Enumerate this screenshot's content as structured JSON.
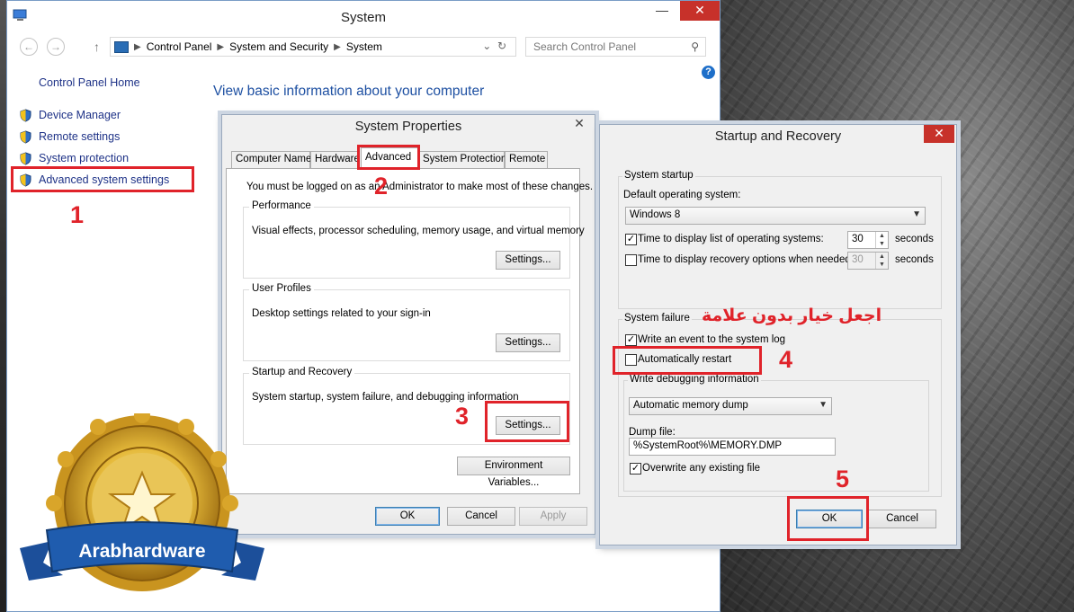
{
  "system_window": {
    "title": "System",
    "breadcrumb": [
      "Control Panel",
      "System and Security",
      "System"
    ],
    "search_placeholder": "Search Control Panel",
    "help_label": "?",
    "left_nav": {
      "home": "Control Panel Home",
      "items": [
        "Device Manager",
        "Remote settings",
        "System protection",
        "Advanced system settings"
      ]
    },
    "heading": "View basic information about your computer"
  },
  "system_properties": {
    "title": "System Properties",
    "tabs": [
      "Computer Name",
      "Hardware",
      "Advanced",
      "System Protection",
      "Remote"
    ],
    "active_tab": "Advanced",
    "admin_note": "You must be logged on as an Administrator to make most of these changes.",
    "performance": {
      "label": "Performance",
      "description": "Visual effects, processor scheduling, memory usage, and virtual memory",
      "button": "Settings..."
    },
    "user_profiles": {
      "label": "User Profiles",
      "description": "Desktop settings related to your sign-in",
      "button": "Settings..."
    },
    "startup_recovery": {
      "label": "Startup and Recovery",
      "description": "System startup, system failure, and debugging information",
      "button": "Settings..."
    },
    "env_button": "Environment Variables...",
    "ok": "OK",
    "cancel": "Cancel",
    "apply": "Apply"
  },
  "startup_recovery": {
    "title": "Startup and Recovery",
    "system_startup": {
      "label": "System startup",
      "default_os_label": "Default operating system:",
      "default_os_value": "Windows 8",
      "time_list_label": "Time to display list of operating systems:",
      "time_list_checked": true,
      "time_list_value": "30",
      "time_recovery_label": "Time to display recovery options when needed:",
      "time_recovery_checked": false,
      "time_recovery_value": "30",
      "seconds": "seconds"
    },
    "system_failure": {
      "label": "System failure",
      "write_event_label": "Write an event to the system log",
      "write_event_checked": true,
      "auto_restart_label": "Automatically restart",
      "auto_restart_checked": false,
      "debug_label": "Write debugging information",
      "debug_value": "Automatic memory dump",
      "dump_file_label": "Dump file:",
      "dump_file_value": "%SystemRoot%\\MEMORY.DMP",
      "overwrite_label": "Overwrite any existing file",
      "overwrite_checked": true
    },
    "ok": "OK",
    "cancel": "Cancel"
  },
  "annotations": {
    "steps": [
      "1",
      "2",
      "3",
      "4",
      "5"
    ],
    "arabic_note": "اجعل خيار بدون علامة",
    "accent": "#e0232a"
  },
  "watermark": {
    "text": "Arabhardware"
  },
  "icons": [
    "computer-icon",
    "back-arrow-icon",
    "forward-arrow-icon",
    "up-arrow-icon",
    "refresh-icon",
    "search-icon",
    "help-icon",
    "shield-icon",
    "close-icon",
    "minimize-icon",
    "maximize-icon",
    "chevron-down-icon"
  ]
}
